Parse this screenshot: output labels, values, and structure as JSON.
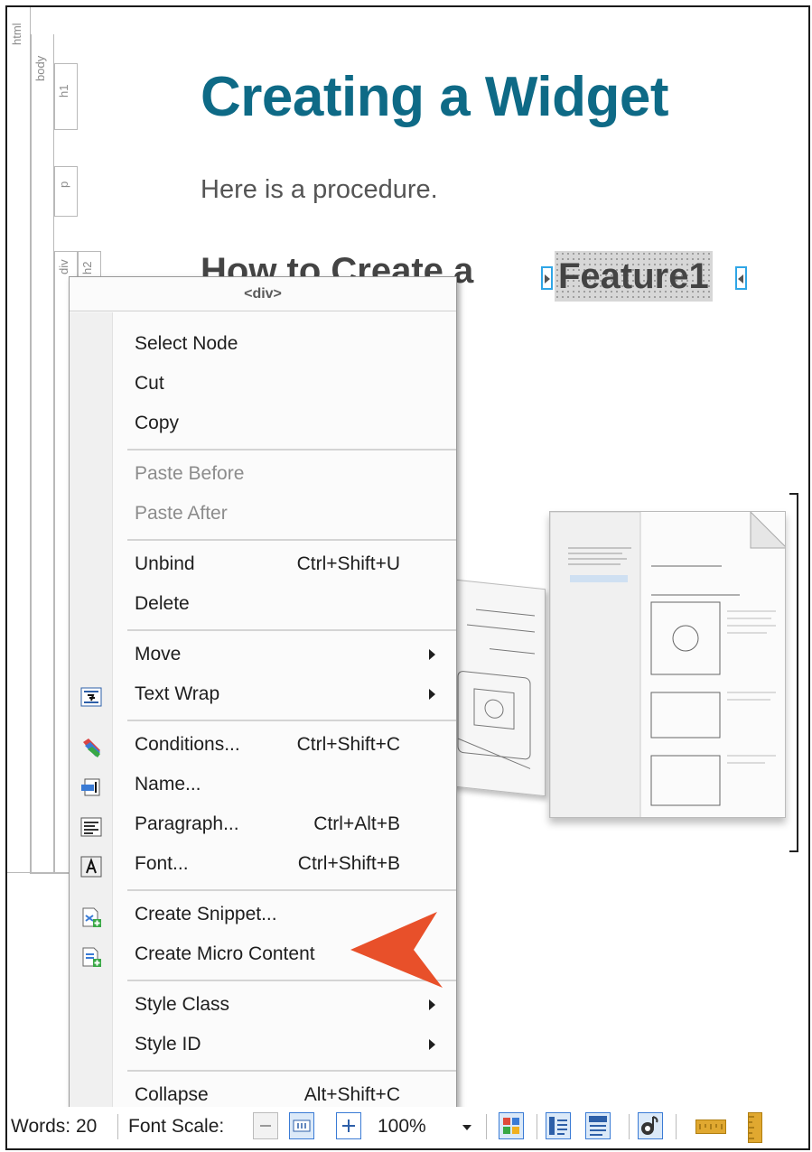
{
  "structure": {
    "html": "html",
    "body": "body",
    "h1": "h1",
    "p": "p",
    "div": "div",
    "h2": "h2"
  },
  "document": {
    "title": "Creating a Widget",
    "paragraph": "Here is a procedure.",
    "heading_prefix": "How to Create a ",
    "variable": "Feature1"
  },
  "context_menu": {
    "header": "<div>",
    "items": [
      {
        "label": "Select Node"
      },
      {
        "label": "Cut"
      },
      {
        "label": "Copy"
      },
      {
        "label": "Paste Before"
      },
      {
        "label": "Paste After"
      },
      {
        "label": "Unbind",
        "shortcut": "Ctrl+Shift+U"
      },
      {
        "label": "Delete"
      },
      {
        "label": "Move"
      },
      {
        "label": "Text Wrap"
      },
      {
        "label": "Conditions...",
        "shortcut": "Ctrl+Shift+C"
      },
      {
        "label": "Name..."
      },
      {
        "label": "Paragraph...",
        "shortcut": "Ctrl+Alt+B"
      },
      {
        "label": "Font...",
        "shortcut": "Ctrl+Shift+B"
      },
      {
        "label": "Create Snippet..."
      },
      {
        "label": "Create Micro Content"
      },
      {
        "label": "Style Class"
      },
      {
        "label": "Style ID"
      },
      {
        "label": "Collapse",
        "shortcut": "Alt+Shift+C"
      }
    ]
  },
  "status_bar": {
    "words": "Words: 20",
    "font_scale_label": "Font Scale:",
    "zoom": "100%"
  },
  "colors": {
    "title": "#0e6a86",
    "arrow": "#e8502a",
    "tag_marker": "#2fa6e6"
  }
}
